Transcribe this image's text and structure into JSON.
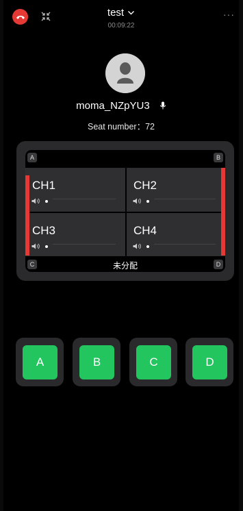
{
  "header": {
    "title": "test",
    "timer": "00:09:22",
    "more_label": "···"
  },
  "profile": {
    "username": "moma_NZpYU3",
    "seat_text": "Seat number：72"
  },
  "panel": {
    "corners": {
      "a": "A",
      "b": "B",
      "c": "C",
      "d": "D"
    },
    "channels": [
      {
        "label": "CH1"
      },
      {
        "label": "CH2"
      },
      {
        "label": "CH3"
      },
      {
        "label": "CH4"
      }
    ],
    "unassigned_label": "未分配"
  },
  "buttons": [
    "A",
    "B",
    "C",
    "D"
  ],
  "colors": {
    "accent_green": "#22c55e",
    "hangup_red": "#e53935"
  },
  "icons": [
    "hangup-icon",
    "shrink-icon",
    "chevron-down-icon",
    "more-icon",
    "avatar-icon",
    "mic-icon",
    "speaker-icon"
  ]
}
